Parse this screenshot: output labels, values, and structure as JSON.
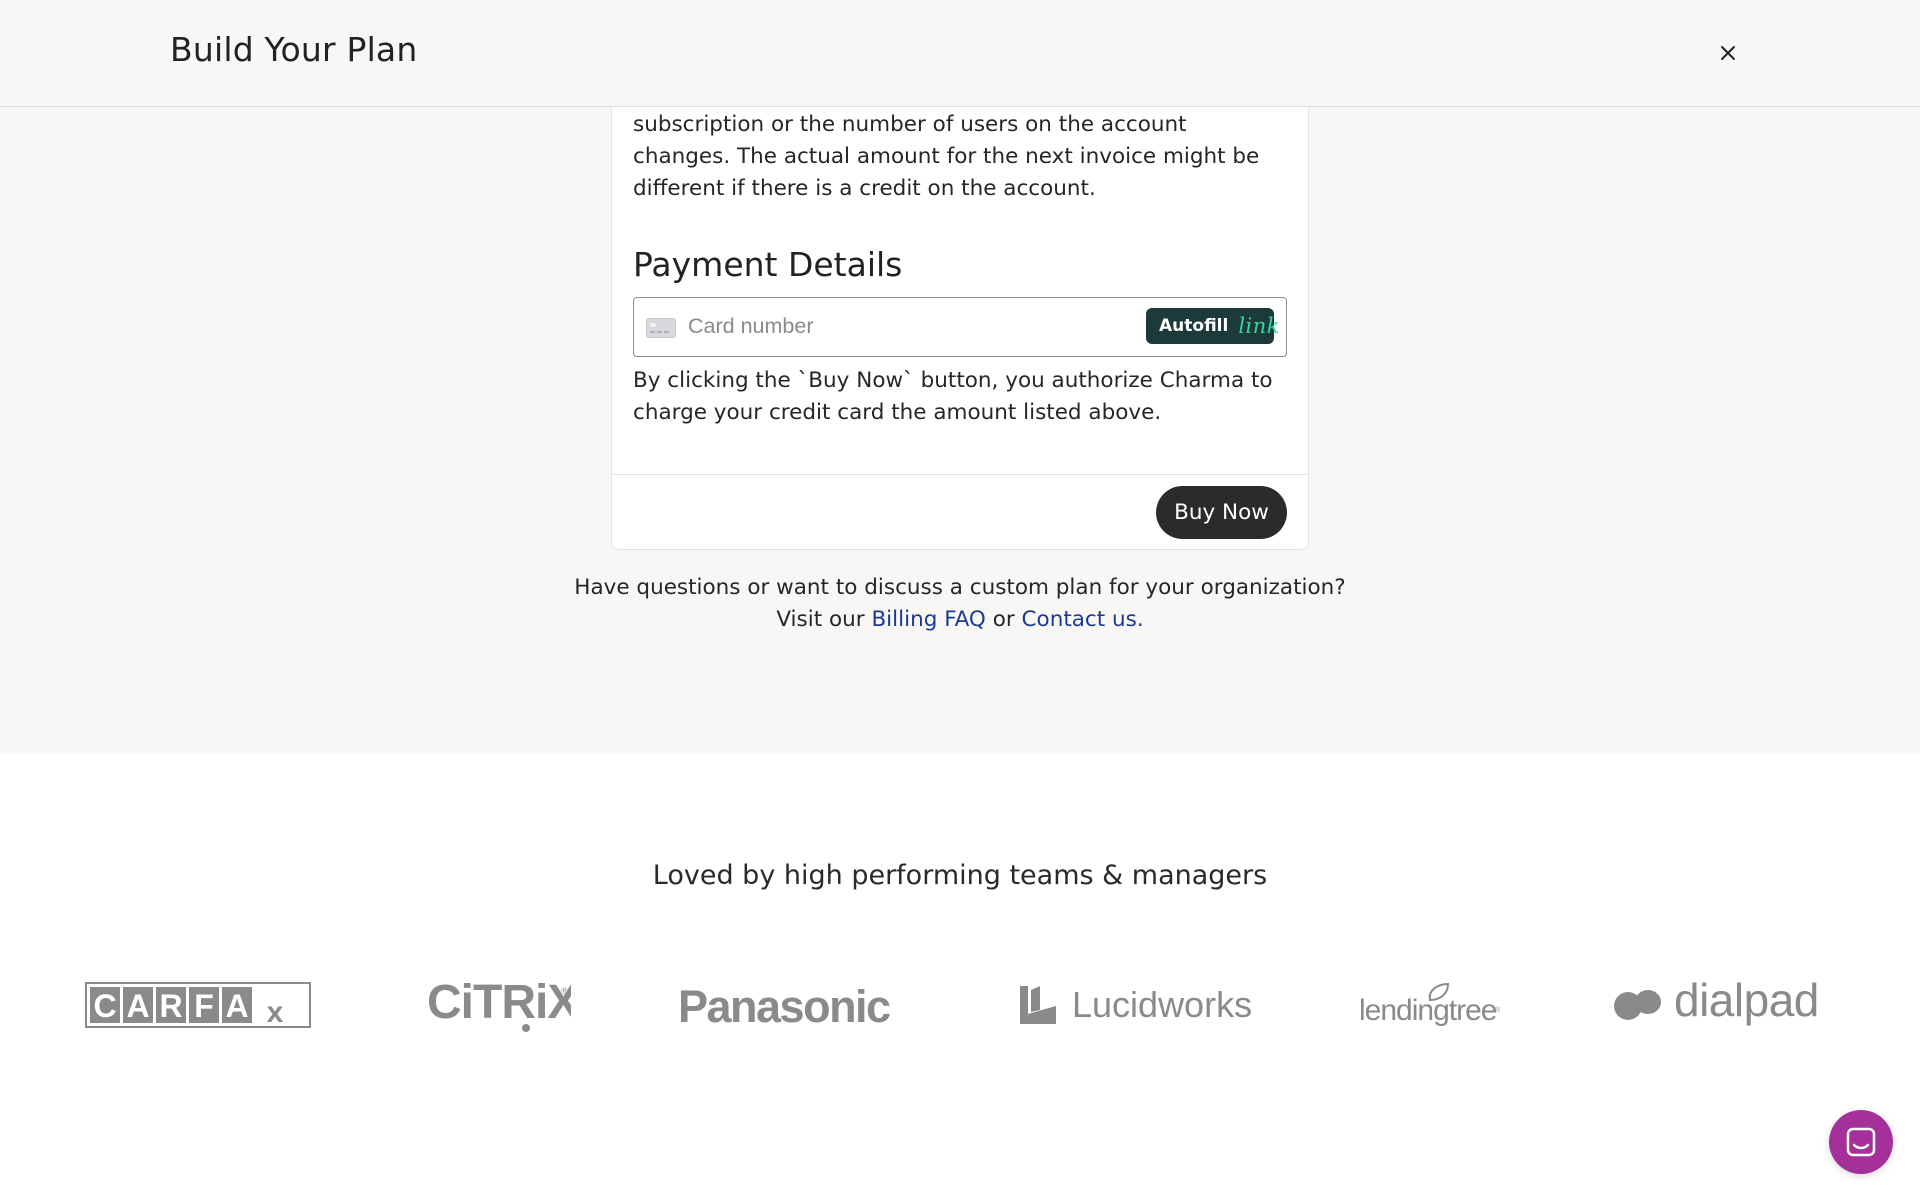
{
  "header": {
    "title": "Build Your Plan",
    "close_icon": "close-icon"
  },
  "checkout": {
    "invoice_note": "subscription or the number of users on the account changes. The actual amount for the next invoice might be different if there is a credit on the account.",
    "payment_title": "Payment Details",
    "card_field": {
      "placeholder": "Card number",
      "value": "",
      "icon": "credit-card-icon",
      "autofill_label": "Autofill",
      "autofill_brand": "link"
    },
    "authorize_text": "By clicking the `Buy Now` button, you authorize Charma to charge your credit card the amount listed above.",
    "buy_label": "Buy Now"
  },
  "help": {
    "line1": "Have questions or want to discuss a custom plan for your organization?",
    "visit_prefix": "Visit our",
    "billing_faq_link": "Billing FAQ",
    "or_text": "or",
    "contact_link": "Contact us."
  },
  "customers": {
    "heading": "Loved by high performing teams & managers",
    "logos": [
      "CARFAX",
      "CiTRiX",
      "Panasonic",
      "Lucidworks",
      "lendingtree",
      "dialpad"
    ]
  },
  "chat": {
    "icon": "chat-icon"
  },
  "colors": {
    "accent_dark": "#2b2b2b",
    "link": "#1c3a8e",
    "autofill_bg": "#1d3a3a",
    "link_brand": "#32d8a0",
    "chat_launcher": "#a4319a",
    "page_bg": "#f8f7f6",
    "logo_grey": "#8a8a8a"
  }
}
